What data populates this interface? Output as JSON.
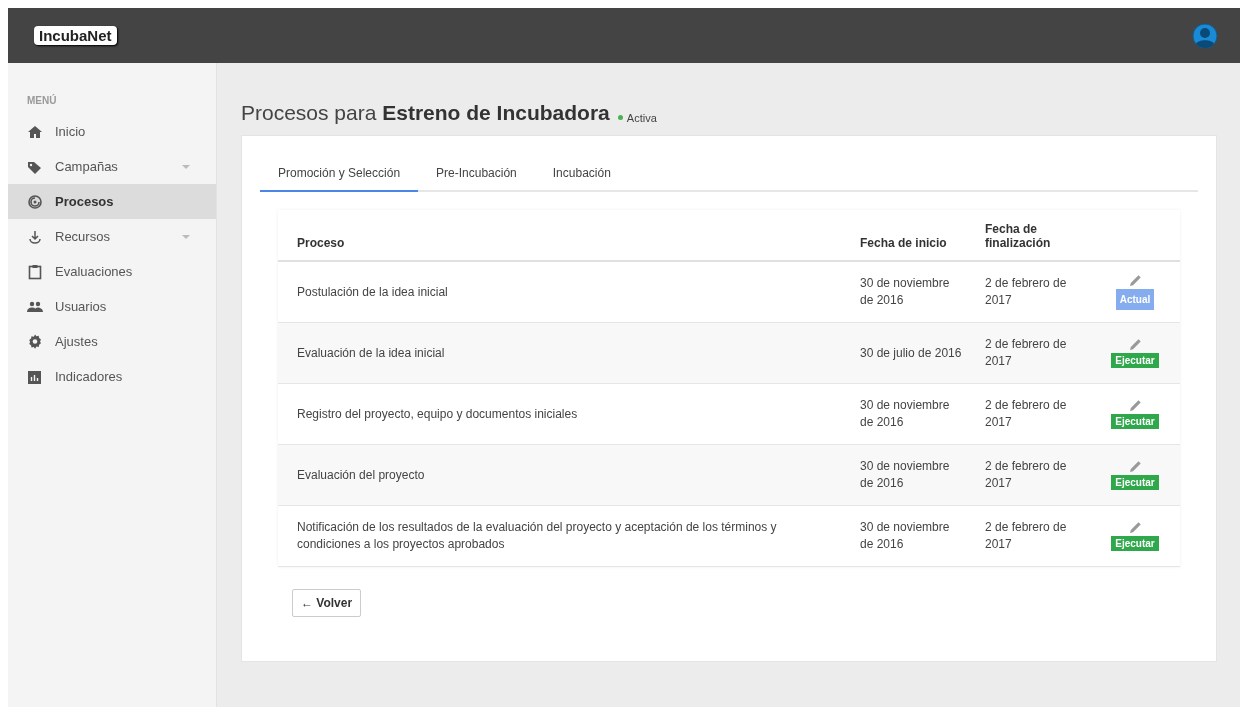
{
  "header": {
    "logo": "IncubaNet"
  },
  "sidebar": {
    "heading": "MENÚ",
    "items": [
      {
        "label": "Inicio",
        "selected": false,
        "expandable": false
      },
      {
        "label": "Campañas",
        "selected": false,
        "expandable": true
      },
      {
        "label": "Procesos",
        "selected": true,
        "expandable": false
      },
      {
        "label": "Recursos",
        "selected": false,
        "expandable": true
      },
      {
        "label": "Evaluaciones",
        "selected": false,
        "expandable": false
      },
      {
        "label": "Usuarios",
        "selected": false,
        "expandable": false
      },
      {
        "label": "Ajustes",
        "selected": false,
        "expandable": false
      },
      {
        "label": "Indicadores",
        "selected": false,
        "expandable": false
      }
    ]
  },
  "page": {
    "title_prefix": "Procesos para",
    "title_name": "Estreno de Incubadora",
    "status": "Activa"
  },
  "tabs": [
    {
      "label": "Promoción y Selección",
      "selected": true
    },
    {
      "label": "Pre-Incubación",
      "selected": false
    },
    {
      "label": "Incubación",
      "selected": false
    }
  ],
  "table": {
    "columns": [
      "Proceso",
      "Fecha de inicio",
      "Fecha de finalización"
    ],
    "rows": [
      {
        "process": "Postulación de la idea inicial",
        "start": "30 de noviembre de 2016",
        "end": "2 de febrero de 2017",
        "action": {
          "kind": "current",
          "label": "Actual"
        }
      },
      {
        "process": "Evaluación de la idea inicial",
        "start": "30 de julio de 2016",
        "end": "2 de febrero de 2017",
        "action": {
          "kind": "execute",
          "label": "Ejecutar"
        }
      },
      {
        "process": "Registro del proyecto, equipo y documentos iniciales",
        "start": "30 de noviembre de 2016",
        "end": "2 de febrero de 2017",
        "action": {
          "kind": "execute",
          "label": "Ejecutar"
        }
      },
      {
        "process": "Evaluación del proyecto",
        "start": "30 de noviembre de 2016",
        "end": "2 de febrero de 2017",
        "action": {
          "kind": "execute",
          "label": "Ejecutar"
        }
      },
      {
        "process": "Notificación de los resultados de la evaluación del proyecto y aceptación de los términos y condiciones a los proyectos aprobados",
        "start": "30 de noviembre de 2016",
        "end": "2 de febrero de 2017",
        "action": {
          "kind": "execute",
          "label": "Ejecutar"
        }
      }
    ]
  },
  "back_button": "← Volver"
}
